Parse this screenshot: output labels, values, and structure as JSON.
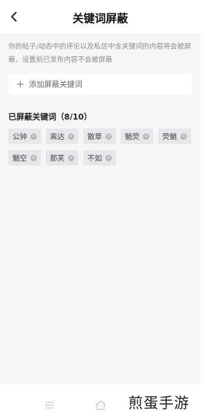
{
  "header": {
    "title": "关键词屏蔽"
  },
  "description": "你的帖子/动态中的评论以及私信中含关键词的内容将会被屏蔽，设置前已发布内容不会被屏蔽",
  "add_keyword": {
    "plus": "+",
    "label": "添加屏蔽关键词"
  },
  "blocked": {
    "title": "已屏蔽关键词（8/10）",
    "tags": [
      {
        "text": "公钟"
      },
      {
        "text": "离达"
      },
      {
        "text": "散草"
      },
      {
        "text": "魈荧"
      },
      {
        "text": "荧魈"
      },
      {
        "text": "魈空"
      },
      {
        "text": "那芙"
      },
      {
        "text": "不如"
      }
    ]
  },
  "watermark": "煎蛋手游",
  "icons": {
    "back": "chevron-left-icon",
    "remove": "close-circle-icon",
    "menu": "menu-icon",
    "home": "home-icon"
  }
}
